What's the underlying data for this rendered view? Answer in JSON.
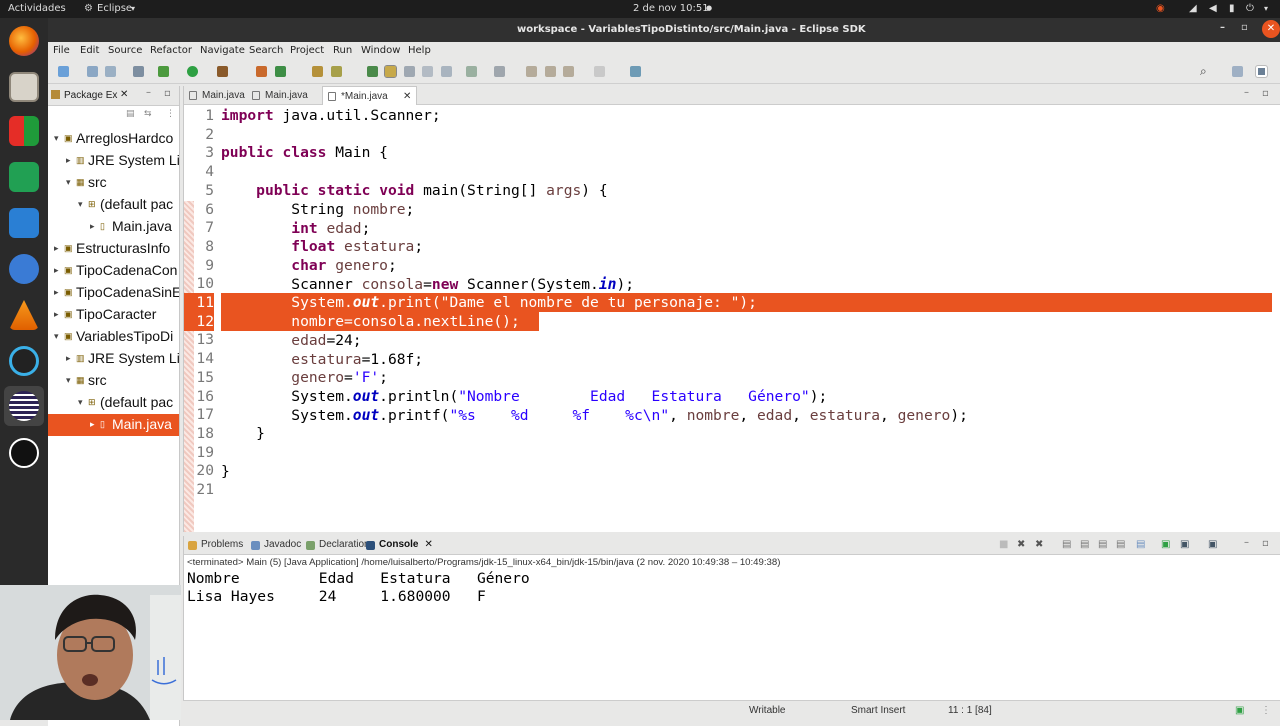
{
  "system": {
    "activities": "Actividades",
    "app_menu": "Eclipse",
    "clock": "2 de nov  10:51"
  },
  "window": {
    "title": "workspace - VariablesTipoDistinto/src/Main.java - Eclipse SDK"
  },
  "menu": [
    "File",
    "Edit",
    "Source",
    "Refactor",
    "Navigate",
    "Search",
    "Project",
    "Run",
    "Window",
    "Help"
  ],
  "package_explorer": {
    "title": "Package Ex",
    "items": [
      {
        "label": "ArreglosHardco",
        "indent": 0,
        "expanded": true,
        "icon": "project"
      },
      {
        "label": "JRE System Li",
        "indent": 1,
        "expanded": false,
        "icon": "library"
      },
      {
        "label": "src",
        "indent": 1,
        "expanded": true,
        "icon": "folder"
      },
      {
        "label": "(default pac",
        "indent": 2,
        "expanded": true,
        "icon": "package"
      },
      {
        "label": "Main.java",
        "indent": 3,
        "expanded": false,
        "icon": "file"
      },
      {
        "label": "EstructurasInfo",
        "indent": 0,
        "expanded": false,
        "icon": "project"
      },
      {
        "label": "TipoCadenaCon",
        "indent": 0,
        "expanded": false,
        "icon": "project"
      },
      {
        "label": "TipoCadenaSinE",
        "indent": 0,
        "expanded": false,
        "icon": "project"
      },
      {
        "label": "TipoCaracter",
        "indent": 0,
        "expanded": false,
        "icon": "project"
      },
      {
        "label": "VariablesTipoDi",
        "indent": 0,
        "expanded": true,
        "icon": "project"
      },
      {
        "label": "JRE System Li",
        "indent": 1,
        "expanded": false,
        "icon": "library"
      },
      {
        "label": "src",
        "indent": 1,
        "expanded": true,
        "icon": "folder"
      },
      {
        "label": "(default pac",
        "indent": 2,
        "expanded": true,
        "icon": "package"
      },
      {
        "label": "Main.java",
        "indent": 3,
        "expanded": false,
        "icon": "file",
        "selected": true
      }
    ]
  },
  "editor": {
    "tabs": [
      {
        "label": "Main.java",
        "active": false
      },
      {
        "label": "Main.java",
        "active": false
      },
      {
        "label": "*Main.java",
        "active": true
      }
    ],
    "line_numbers": [
      "1",
      "2",
      "3",
      "4",
      "5",
      "6",
      "7",
      "8",
      "9",
      "10",
      "11",
      "12",
      "13",
      "14",
      "15",
      "16",
      "17",
      "18",
      "19",
      "20",
      "21"
    ]
  },
  "bottom_panel": {
    "tabs": [
      "Problems",
      "Javadoc",
      "Declaration",
      "Console"
    ],
    "active_tab": "Console",
    "terminated": "<terminated> Main (5) [Java Application] /home/luisalberto/Programs/jdk-15_linux-x64_bin/jdk-15/bin/java  (2 nov. 2020 10:49:38 – 10:49:38)",
    "output": [
      "Nombre         Edad   Estatura   Género",
      "Lisa Hayes     24     1.680000   F"
    ]
  },
  "status": {
    "writable": "Writable",
    "insert_mode": "Smart Insert",
    "position": "11 : 1 [84]"
  },
  "colors": {
    "accent": "#e95420",
    "keyword": "#7f0055",
    "string": "#2a00ff"
  }
}
